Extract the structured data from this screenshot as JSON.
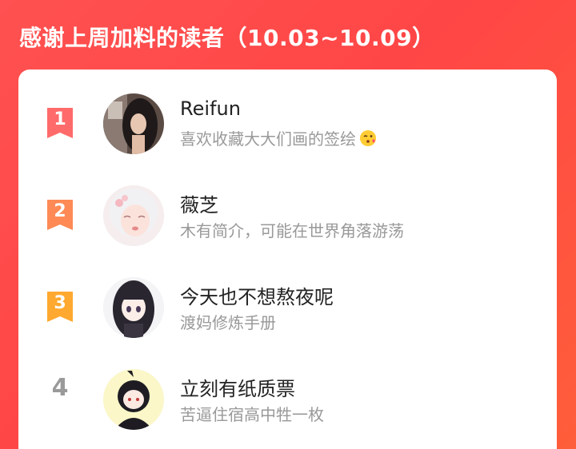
{
  "header": {
    "title": "感谢上周加料的读者（10.03~10.09）"
  },
  "colors": {
    "background": "#ff4b4b",
    "rank1": "#ff6b6b",
    "rank2": "#ff8a55",
    "rank3": "#ffa930",
    "rank_other": "#9a9a9a"
  },
  "readers": [
    {
      "rank": "1",
      "name": "Reifun",
      "desc": "喜欢收藏大大们画的签绘",
      "desc_emoji": "kissing-face-emoji",
      "avatar": "avatar-photo-girl-long-hair"
    },
    {
      "rank": "2",
      "name": "薇芝",
      "desc": "木有简介，可能在世界角落游荡",
      "avatar": "avatar-anime-white-hair"
    },
    {
      "rank": "3",
      "name": "今天也不想熬夜呢",
      "desc": "渡妈修炼手册",
      "avatar": "avatar-anime-black-hair"
    },
    {
      "rank": "4",
      "name": "立刻有纸质票",
      "desc": "苦逼住宿高中牲一枚",
      "avatar": "avatar-chibi-black-hair"
    }
  ]
}
